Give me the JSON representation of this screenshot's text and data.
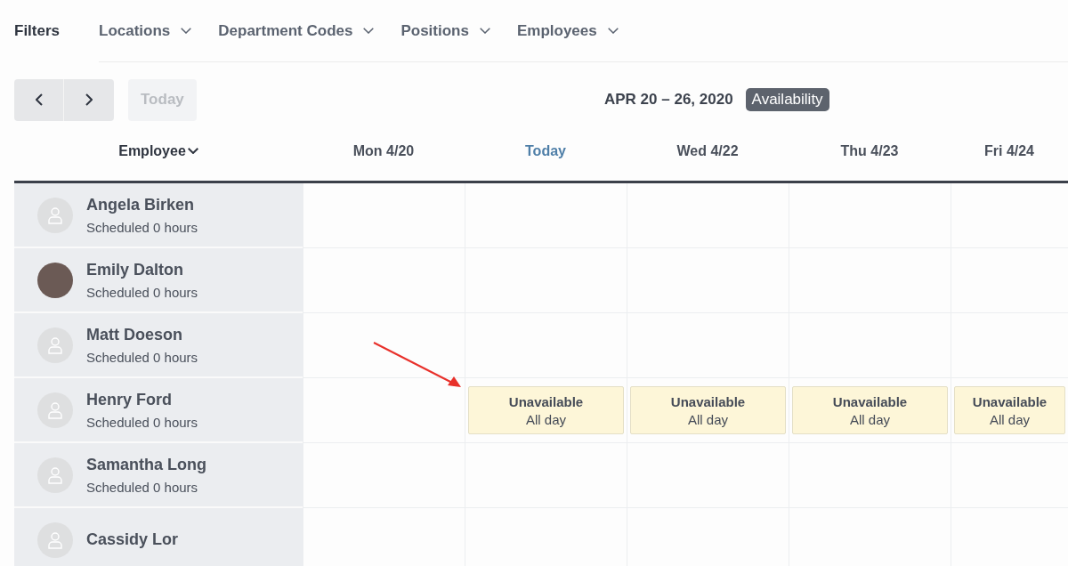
{
  "filters": {
    "title": "Filters",
    "items": [
      "Locations",
      "Department Codes",
      "Positions",
      "Employees"
    ]
  },
  "toolbar": {
    "today": {
      "label": "Today",
      "disabled": true
    },
    "range": "APR 20 – 26, 2020",
    "view_badge": "Availability"
  },
  "table": {
    "employee_header": "Employee",
    "days": [
      {
        "label": "Mon 4/20",
        "selected": false
      },
      {
        "label": "Today",
        "selected": true
      },
      {
        "label": "Wed 4/22",
        "selected": false
      },
      {
        "label": "Thu 4/23",
        "selected": false
      },
      {
        "label": "Fri 4/24",
        "selected": false
      }
    ],
    "rows": [
      {
        "name": "Angela Birken",
        "hours": "Scheduled 0 hours",
        "kind": "placeholder",
        "cells": [
          {
            "kind": "empty"
          },
          {
            "kind": "empty"
          },
          {
            "kind": "empty"
          },
          {
            "kind": "empty"
          },
          {
            "kind": "empty"
          }
        ]
      },
      {
        "name": "Emily Dalton",
        "hours": "Scheduled 0 hours",
        "kind": "photo",
        "cells": [
          {
            "kind": "empty"
          },
          {
            "kind": "empty"
          },
          {
            "kind": "empty"
          },
          {
            "kind": "empty"
          },
          {
            "kind": "empty"
          }
        ]
      },
      {
        "name": "Matt Doeson",
        "hours": "Scheduled 0 hours",
        "kind": "placeholder",
        "cells": [
          {
            "kind": "empty"
          },
          {
            "kind": "empty"
          },
          {
            "kind": "empty"
          },
          {
            "kind": "empty"
          },
          {
            "kind": "empty"
          }
        ]
      },
      {
        "name": "Henry Ford",
        "hours": "Scheduled 0 hours",
        "kind": "placeholder",
        "cells": [
          {
            "kind": "empty"
          },
          {
            "kind": "unavailable",
            "title": "Unavailable",
            "detail": "All day"
          },
          {
            "kind": "unavailable",
            "title": "Unavailable",
            "detail": "All day"
          },
          {
            "kind": "unavailable",
            "title": "Unavailable",
            "detail": "All day"
          },
          {
            "kind": "unavailable",
            "title": "Unavailable",
            "detail": "All day"
          }
        ]
      },
      {
        "name": "Samantha Long",
        "hours": "Scheduled 0 hours",
        "kind": "placeholder",
        "cells": [
          {
            "kind": "empty"
          },
          {
            "kind": "empty"
          },
          {
            "kind": "empty"
          },
          {
            "kind": "empty"
          },
          {
            "kind": "empty"
          }
        ]
      },
      {
        "name": "Cassidy Lor",
        "kind": "placeholder",
        "cells": [
          {
            "kind": "empty"
          },
          {
            "kind": "empty"
          },
          {
            "kind": "empty"
          },
          {
            "kind": "empty"
          },
          {
            "kind": "empty"
          }
        ]
      }
    ]
  }
}
